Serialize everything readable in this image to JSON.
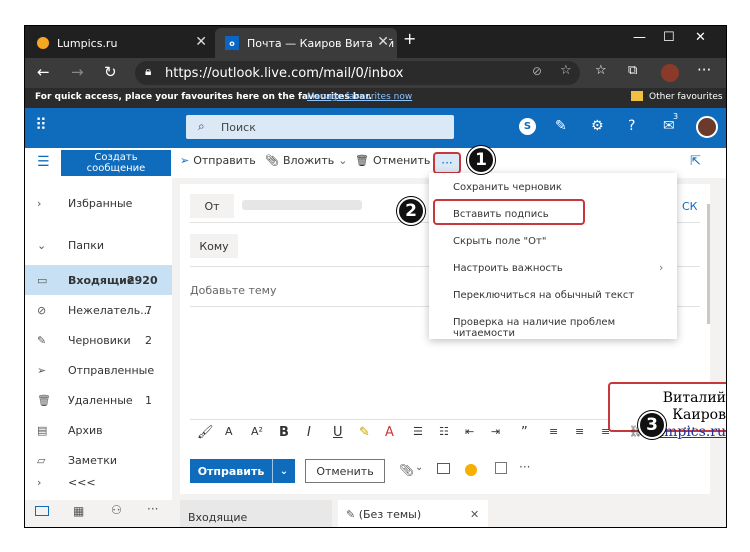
{
  "browser": {
    "tabs": [
      {
        "label": "Lumpics.ru"
      },
      {
        "label": "Почта — Каиров Виталий — Ou"
      }
    ],
    "url": "https://outlook.live.com/mail/0/inbox",
    "favbar_text": "For quick access, place your favourites here on the favourites bar.",
    "favbar_link": "Manage favourites now",
    "other_favourites": "Other favourites",
    "window_controls": {
      "minimize": "—",
      "maximize": "☐",
      "close": "✕"
    },
    "new_tab": "+"
  },
  "topbar": {
    "search_placeholder": "Поиск",
    "notification_count": "3"
  },
  "commandbar": {
    "new_message": "Создать сообщение",
    "send": "Отправить",
    "attach": "Вложить",
    "cancel": "Отменить",
    "more": "···"
  },
  "sidebar": {
    "favorites": "Избранные",
    "folders": "Папки",
    "items": [
      {
        "label": "Входящие",
        "count": "2920"
      },
      {
        "label": "Нежелатель...",
        "count": "7"
      },
      {
        "label": "Черновики",
        "count": "2"
      },
      {
        "label": "Отправленные",
        "count": ""
      },
      {
        "label": "Удаленные",
        "count": "1"
      },
      {
        "label": "Архив",
        "count": ""
      },
      {
        "label": "Заметки",
        "count": ""
      },
      {
        "label": "<<<",
        "count": ""
      }
    ]
  },
  "compose": {
    "from_label": "От",
    "cc_label": "СК",
    "to_label": "Кому",
    "subject_placeholder": "Добавьте тему",
    "signature_line1": "Виталий Каиров",
    "signature_line2": "Lumpics.ru",
    "send_button": "Отправить",
    "cancel_button": "Отменить",
    "more_format": "···"
  },
  "more_menu": {
    "items": [
      {
        "label": "Сохранить черновик"
      },
      {
        "label": "Вставить подпись"
      },
      {
        "label": "Скрыть поле \"От\""
      },
      {
        "label": "Настроить важность"
      },
      {
        "label": "Переключиться на обычный текст"
      },
      {
        "label": "Проверка на наличие проблем читаемости"
      }
    ]
  },
  "callouts": [
    "1",
    "2",
    "3"
  ],
  "bottom": {
    "inbox_tab": "Входящие",
    "draft_tab": "(Без темы)"
  },
  "colors": {
    "brand": "#0f6cbd",
    "highlight": "#c8373a",
    "selected_row": "#c7e0f4"
  }
}
